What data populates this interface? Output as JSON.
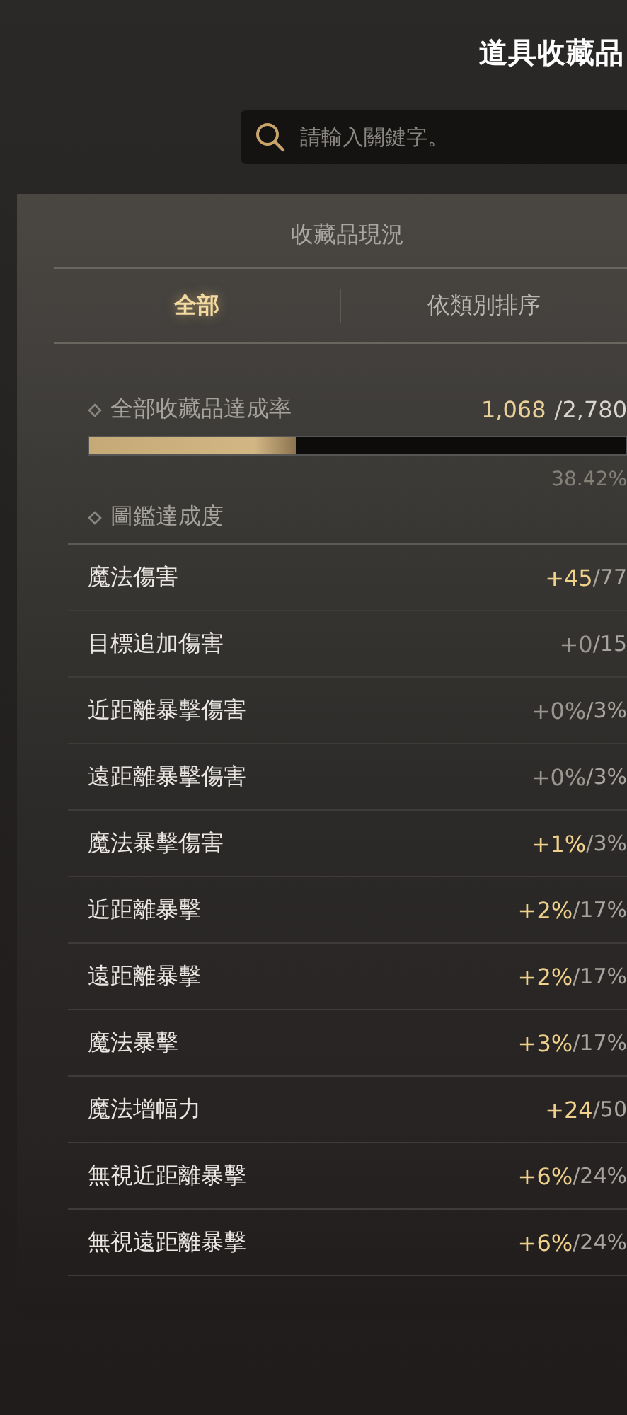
{
  "header": {
    "title": "道具收藏品"
  },
  "search": {
    "placeholder": "請輸入關鍵字。"
  },
  "panel": {
    "title": "收藏品現況",
    "tabs": [
      {
        "label": "全部",
        "selected": true
      },
      {
        "label": "依類別排序",
        "selected": false
      }
    ],
    "overall": {
      "label": "全部收藏品達成率",
      "count": "1,068",
      "total": "/2,780",
      "level": 0.3842,
      "percent": "38.42%"
    },
    "codex": {
      "label": "圖鑑達成度"
    },
    "stats": [
      {
        "name": "魔法傷害",
        "gain": "+45",
        "max": "/77",
        "achieved": true
      },
      {
        "name": "目標追加傷害",
        "gain": "+0",
        "max": "/15",
        "achieved": false
      },
      {
        "name": "近距離暴擊傷害",
        "gain": "+0%",
        "max": "/3%",
        "achieved": false
      },
      {
        "name": "遠距離暴擊傷害",
        "gain": "+0%",
        "max": "/3%",
        "achieved": false
      },
      {
        "name": "魔法暴擊傷害",
        "gain": "+1%",
        "max": "/3%",
        "achieved": true
      },
      {
        "name": "近距離暴擊",
        "gain": "+2%",
        "max": "/17%",
        "achieved": true
      },
      {
        "name": "遠距離暴擊",
        "gain": "+2%",
        "max": "/17%",
        "achieved": true
      },
      {
        "name": "魔法暴擊",
        "gain": "+3%",
        "max": "/17%",
        "achieved": true
      },
      {
        "name": "魔法增幅力",
        "gain": "+24",
        "max": "/50",
        "achieved": true
      },
      {
        "name": "無視近距離暴擊",
        "gain": "+6%",
        "max": "/24%",
        "achieved": true
      },
      {
        "name": "無視遠距離暴擊",
        "gain": "+6%",
        "max": "/24%",
        "achieved": true
      }
    ]
  }
}
